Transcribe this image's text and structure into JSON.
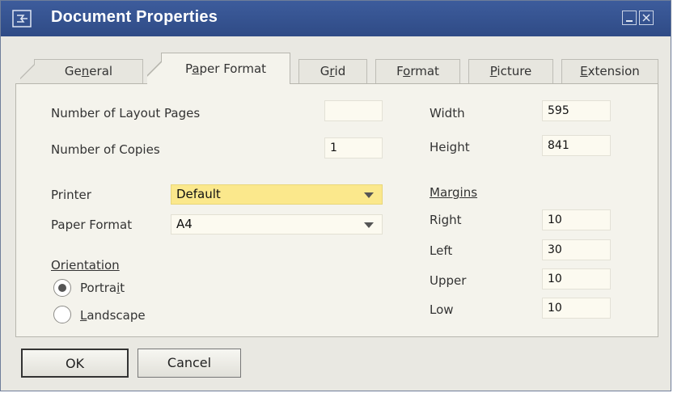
{
  "window": {
    "title": "Document Properties",
    "title_icon": "document-properties-icon",
    "minimize_icon": "minimize-icon",
    "close_icon": "close-icon"
  },
  "tabs": [
    {
      "label": "General",
      "underline_char": "n",
      "active": false
    },
    {
      "label": "Paper Format",
      "underline_char": "a",
      "active": true
    },
    {
      "label": "Grid",
      "underline_char": "r",
      "active": false
    },
    {
      "label": "Format",
      "underline_char": "o",
      "active": false
    },
    {
      "label": "Picture",
      "underline_char": "P",
      "active": false
    },
    {
      "label": "Extension",
      "underline_char": "E",
      "active": false
    }
  ],
  "left": {
    "layout_pages_label": "Number of Layout Pages",
    "layout_pages_value": "",
    "copies_label": "Number of Copies",
    "copies_value": "1",
    "printer_label": "Printer",
    "printer_value": "Default",
    "paper_format_label": "Paper Format",
    "paper_format_value": "A4",
    "orientation_label": "Orientation",
    "portrait_label": "Portrait",
    "landscape_label": "Landscape",
    "orientation_selected": "Portrait"
  },
  "right": {
    "width_label": "Width",
    "width_value": "595",
    "height_label": "Height",
    "height_value": "841",
    "margins_label": "Margins",
    "right_label": "Right",
    "right_value": "10",
    "left_label": "Left",
    "left_value": "30",
    "upper_label": "Upper",
    "upper_value": "10",
    "low_label": "Low",
    "low_value": "10"
  },
  "buttons": {
    "ok": "OK",
    "cancel": "Cancel"
  },
  "colors": {
    "titlebar": "#3d5c9c",
    "highlight_field": "#fbe88c",
    "panel": "#f4f3ec"
  }
}
